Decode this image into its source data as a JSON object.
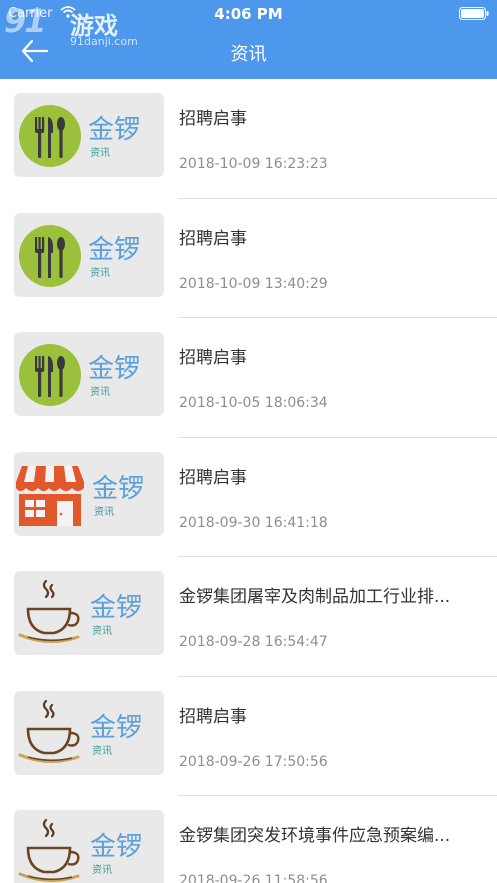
{
  "status_bar": {
    "carrier": "Carrier",
    "time": "4:06 PM"
  },
  "watermark": {
    "logo": "91",
    "name": "游戏",
    "site": "91danji.com"
  },
  "header": {
    "title": "资讯",
    "back_icon": "arrow-left-icon"
  },
  "thumb_text": {
    "brand": "金锣",
    "sub": "资讯"
  },
  "colors": {
    "header_bg": "#4d97ec",
    "title_text": "#333333",
    "date_text": "#8e8e8e"
  },
  "items": [
    {
      "title": "招聘启事",
      "date": "2018-10-09 16:23:23",
      "icon": "fork-knife-icon"
    },
    {
      "title": "招聘启事",
      "date": "2018-10-09 13:40:29",
      "icon": "fork-knife-icon"
    },
    {
      "title": "招聘启事",
      "date": "2018-10-05 18:06:34",
      "icon": "fork-knife-icon"
    },
    {
      "title": "招聘启事",
      "date": "2018-09-30 16:41:18",
      "icon": "store-icon"
    },
    {
      "title": "金锣集团屠宰及肉制品加工行业排...",
      "date": "2018-09-28 16:54:47",
      "icon": "coffee-cup-icon"
    },
    {
      "title": "招聘启事",
      "date": "2018-09-26 17:50:56",
      "icon": "coffee-cup-icon"
    },
    {
      "title": "金锣集团突发环境事件应急预案编...",
      "date": "2018-09-26 11:58:56",
      "icon": "coffee-cup-icon"
    }
  ]
}
